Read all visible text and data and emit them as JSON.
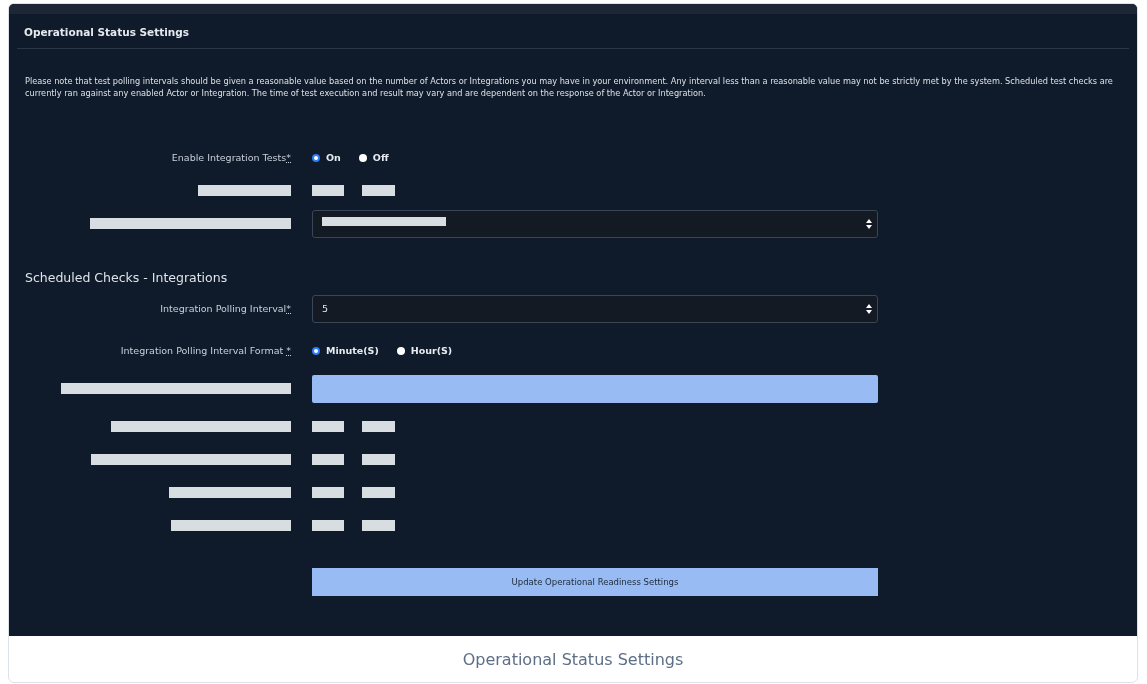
{
  "panel": {
    "title": "Operational Status Settings"
  },
  "notice": "Please note that test polling intervals should be given a reasonable value based on the number of Actors or Integrations you may have in your environment. Any interval less than a reasonable value may not be strictly met by the system. Scheduled test checks are currently ran against any enabled Actor or Integration. The time of test execution and result may vary and are dependent on the response of the Actor or Integration.",
  "rows": [
    {
      "kind": "radio",
      "label": "Enable Integration Tests",
      "required_mark": "*",
      "options": [
        {
          "label": "On",
          "selected": true
        },
        {
          "label": "Off",
          "selected": false
        }
      ]
    },
    {
      "kind": "redacted_radio"
    },
    {
      "kind": "redacted_select"
    },
    {
      "kind": "heading",
      "label": "Scheduled Checks - Integrations"
    },
    {
      "kind": "select",
      "label": "Integration Polling Interval",
      "required_mark": "*",
      "value": "5"
    },
    {
      "kind": "radio",
      "label": "Integration Polling Interval Format ",
      "required_mark": "*",
      "options": [
        {
          "label": "Minute(S)",
          "selected": true
        },
        {
          "label": "Hour(S)",
          "selected": false
        }
      ]
    },
    {
      "kind": "redacted_input"
    },
    {
      "kind": "redacted_radio"
    },
    {
      "kind": "redacted_radio"
    },
    {
      "kind": "redacted_radio"
    },
    {
      "kind": "redacted_radio"
    }
  ],
  "submit_button": "Update Operational Readiness Settings",
  "caption": "Operational Status Settings"
}
